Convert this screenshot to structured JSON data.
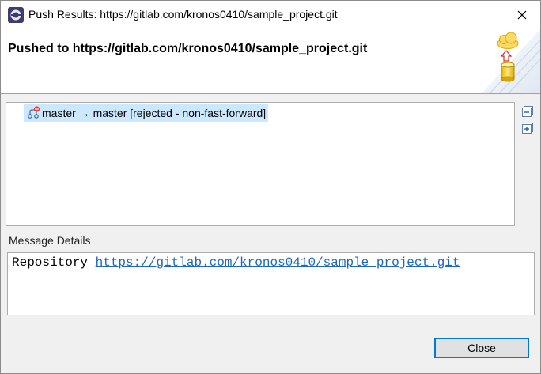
{
  "window": {
    "title": "Push Results: https://gitlab.com/kronos0410/sample_project.git",
    "app_icon": "eclipse-icon",
    "close_icon": "close-icon"
  },
  "banner": {
    "heading": "Pushed to https://gitlab.com/kronos0410/sample_project.git",
    "art_icon": "cloud-push-database-icon"
  },
  "results": {
    "rows": [
      {
        "icon": "branch-rejected-icon",
        "label": "master → master [rejected - non-fast-forward]",
        "selected": true
      }
    ],
    "collapse_all_icon": "collapse-all-icon",
    "expand_all_icon": "expand-all-icon"
  },
  "details": {
    "label": "Message Details",
    "prefix": "Repository ",
    "link": "https://gitlab.com/kronos0410/sample_project.git"
  },
  "footer": {
    "close_button": "Close",
    "close_mnemonic": "C",
    "close_rest": "lose"
  },
  "colors": {
    "selection": "#cce8ff",
    "link": "#1a66c9",
    "focus_border": "#0078d7"
  }
}
